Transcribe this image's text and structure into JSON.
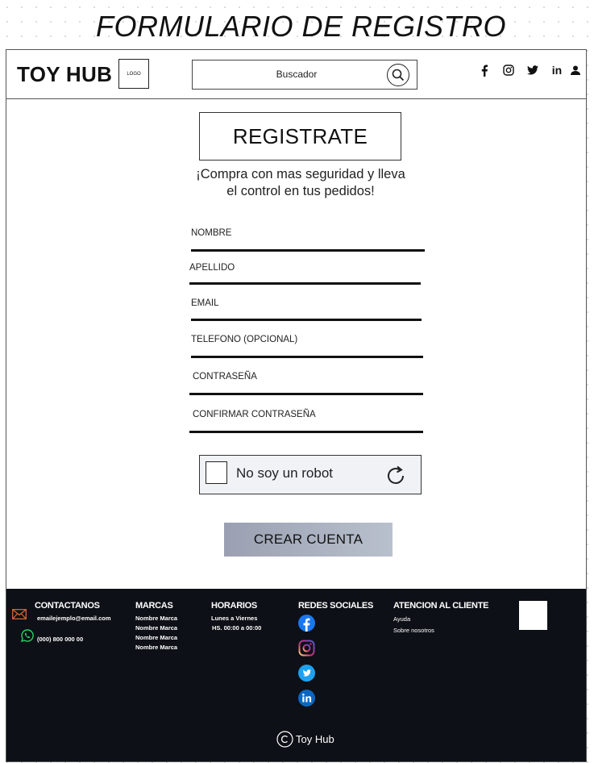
{
  "page_title": "FORMULARIO DE REGISTRO",
  "header": {
    "brand": "TOY HUB",
    "logo_text": "LOGO",
    "search_placeholder": "Buscador",
    "social": [
      {
        "icon": "facebook-icon",
        "glyph": "f"
      },
      {
        "icon": "instagram-icon",
        "glyph": ""
      },
      {
        "icon": "twitter-icon",
        "glyph": ""
      },
      {
        "icon": "linkedin-icon",
        "glyph": "in"
      },
      {
        "icon": "user-icon",
        "glyph": ""
      }
    ]
  },
  "form": {
    "heading": "REGISTRATE",
    "tagline_line1": "¡Compra con mas seguridad y lleva",
    "tagline_line2": "el control en tus pedidos!",
    "fields": {
      "nombre": "NOMBRE",
      "apellido": "APELLIDO",
      "email": "EMAIL",
      "telefono": "TELEFONO (OPCIONAL)",
      "contrasena": "CONTRASEÑA",
      "confirmar": "CONFIRMAR CONTRASEÑA"
    },
    "captcha_label": "No soy un robot",
    "submit_label": "CREAR CUENTA"
  },
  "footer": {
    "contact": {
      "heading": "CONTACTANOS",
      "email": "emailejemplo@email.com",
      "phone": "(000) 800 000 00"
    },
    "brands": {
      "heading": "MARCAS",
      "items": [
        "Nombre Marca",
        "Nombre Marca",
        "Nombre Marca",
        "Nombre Marca"
      ]
    },
    "hours": {
      "heading": "HORARIOS",
      "days": "Lunes a Viernes",
      "time": "HS. 00:00 a 00:00"
    },
    "social": {
      "heading": "REDES SOCIALES"
    },
    "support": {
      "heading": "ATENCION AL CLIENTE",
      "help": "Ayuda",
      "about": "Sobre nosotros"
    },
    "copyright": "Toy Hub"
  },
  "colors": {
    "footer_bg": "#0d1016",
    "button_gradient_start": "#9aa0b1",
    "button_gradient_end": "#b9c0cd",
    "facebook": "#1877f2",
    "twitter": "#1da1f2",
    "linkedin": "#0a66c2",
    "whatsapp": "#25d366",
    "mail": "#e06c3b"
  }
}
